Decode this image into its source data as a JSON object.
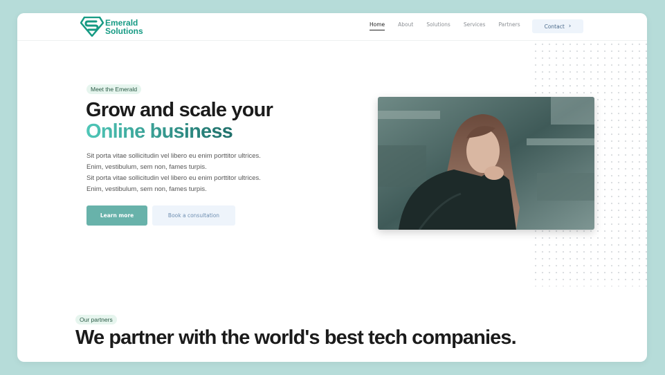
{
  "header": {
    "brand": {
      "line1": "Emerald",
      "line2": "Solutions",
      "icon": "emerald-s-logo-icon"
    },
    "nav": [
      {
        "label": "Home",
        "active": true
      },
      {
        "label": "About",
        "active": false
      },
      {
        "label": "Solutions",
        "active": false
      },
      {
        "label": "Services",
        "active": false
      },
      {
        "label": "Partners",
        "active": false
      }
    ],
    "contact_button": {
      "label": "Contact",
      "icon": "chevron-right-icon"
    }
  },
  "hero": {
    "badge": "Meet the Emerald",
    "title_line1": "Grow and scale your",
    "title_line2": "Online business",
    "paragraph": [
      "Sit porta vitae sollicitudin vel libero eu enim porttitor ultrices.",
      "Enim, vestibulum, sem non, fames turpis.",
      "Sit porta vitae sollicitudin vel libero eu enim porttitor ultrices.",
      "Enim, vestibulum, sem non, fames turpis."
    ],
    "primary_button": "Learn more",
    "secondary_button": "Book a consultation"
  },
  "partners": {
    "badge": "Our partners",
    "title": "We partner with the world's best tech companies."
  },
  "colors": {
    "page_background": "#b6dcd9",
    "brand_green": "#159a83",
    "gradient_start": "#4fc7b8",
    "gradient_end": "#1f6f6a",
    "primary_button": "#68b2aa",
    "secondary_button": "#eef4fb"
  }
}
